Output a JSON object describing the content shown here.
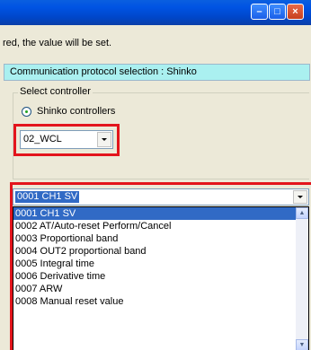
{
  "window": {
    "minimize_glyph": "–",
    "maximize_glyph": "□",
    "close_glyph": "×"
  },
  "message": "red, the value will be set.",
  "protocol_label": "Communication protocol selection : Shinko",
  "controller_group": {
    "title": "Select controller",
    "radio_label": "Shinko controllers",
    "model_value": "02_WCL"
  },
  "parameter": {
    "selected_value": "0001 CH1 SV",
    "options": [
      "0001 CH1 SV",
      "0002 AT/Auto-reset Perform/Cancel",
      "0003 Proportional band",
      "0004 OUT2 proportional band",
      "0005 Integral time",
      "0006 Derivative time",
      "0007 ARW",
      "0008 Manual reset value"
    ]
  },
  "colors": {
    "highlight_box": "#e3141c",
    "protocol_bar": "#aaf0f0",
    "selection": "#316ac5"
  }
}
